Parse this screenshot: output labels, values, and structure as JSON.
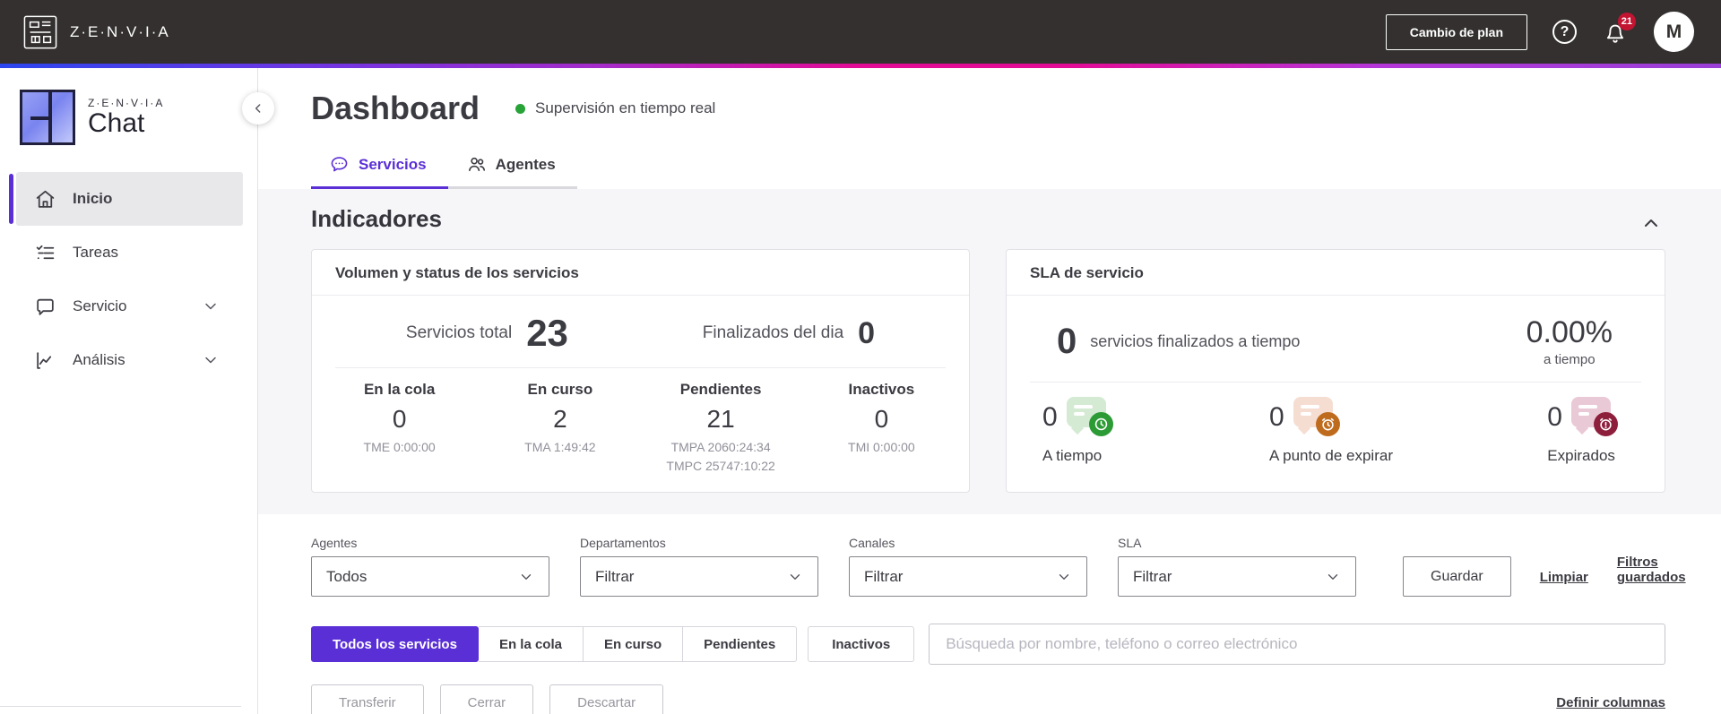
{
  "topbar": {
    "brand": "Z·E·N·V·I·A",
    "change_plan_label": "Cambio de plan",
    "notification_count": "21",
    "avatar_initial": "M"
  },
  "sidebar": {
    "logo_brand": "Z·E·N·V·I·A",
    "logo_product": "Chat",
    "items": [
      {
        "label": "Inicio",
        "icon": "home-icon",
        "active": true
      },
      {
        "label": "Tareas",
        "icon": "tasks-icon"
      },
      {
        "label": "Servicio",
        "icon": "chat-bubble-icon",
        "expandable": true
      },
      {
        "label": "Análisis",
        "icon": "chart-icon",
        "expandable": true
      }
    ]
  },
  "header": {
    "title": "Dashboard",
    "status_text": "Supervisión en tiempo real"
  },
  "tabs": [
    {
      "label": "Servicios",
      "icon": "chat-dots-icon",
      "active": true
    },
    {
      "label": "Agentes",
      "icon": "people-icon",
      "active": false
    }
  ],
  "indicators": {
    "section_title": "Indicadores",
    "volume_card": {
      "title": "Volumen y status de los servicios",
      "totals": [
        {
          "label": "Servicios total",
          "value": "23"
        },
        {
          "label": "Finalizados del dia",
          "value": "0"
        }
      ],
      "stats": [
        {
          "label": "En la cola",
          "value": "0",
          "metrics": [
            "TME 0:00:00"
          ]
        },
        {
          "label": "En curso",
          "value": "2",
          "metrics": [
            "TMA 1:49:42"
          ]
        },
        {
          "label": "Pendientes",
          "value": "21",
          "metrics": [
            "TMPA 2060:24:34",
            "TMPC 25747:10:22"
          ]
        },
        {
          "label": "Inactivos",
          "value": "0",
          "metrics": [
            "TMI 0:00:00"
          ]
        }
      ]
    },
    "sla_card": {
      "title": "SLA de servicio",
      "finished_value": "0",
      "finished_label": "servicios finalizados a tiempo",
      "percent_value": "0.00%",
      "percent_label": "a tiempo",
      "statuses": [
        {
          "value": "0",
          "label": "A tiempo",
          "icon": "clock-badge-icon",
          "color": "#2c9a35"
        },
        {
          "value": "0",
          "label": "A punto de expirar",
          "icon": "alarm-badge-icon",
          "color": "#bf6b1e"
        },
        {
          "value": "0",
          "label": "Expirados",
          "icon": "alarm-alert-badge-icon",
          "color": "#8e1f3c"
        }
      ]
    }
  },
  "filters": {
    "fields": [
      {
        "label": "Agentes",
        "value": "Todos"
      },
      {
        "label": "Departamentos",
        "value": "Filtrar"
      },
      {
        "label": "Canales",
        "value": "Filtrar"
      },
      {
        "label": "SLA",
        "value": "Filtrar"
      }
    ],
    "save_label": "Guardar",
    "clear_label": "Limpiar",
    "saved_filters_label": "Filtros guardados"
  },
  "service_tabs": {
    "segments": [
      "Todos los servicios",
      "En la cola",
      "En curso",
      "Pendientes"
    ],
    "active_segment": "Todos los servicios",
    "inactive_label": "Inactivos",
    "search_placeholder": "Búsqueda por nombre, teléfono o correo electrónico"
  },
  "actions": {
    "transfer_label": "Transferir",
    "close_label": "Cerrar",
    "discard_label": "Descartar",
    "columns_label": "Definir columnas"
  },
  "colors": {
    "accent": "#5b2fd6",
    "topbar_bg": "#33302f",
    "status_green_dot": "#27a337",
    "badge_red": "#c31432",
    "sla_on_time": "#2c9a35",
    "sla_about_to_expire": "#bf6b1e",
    "sla_expired": "#8e1f3c",
    "gradient": [
      "#2b46ef",
      "#e30b95",
      "#9a3fd8"
    ]
  }
}
